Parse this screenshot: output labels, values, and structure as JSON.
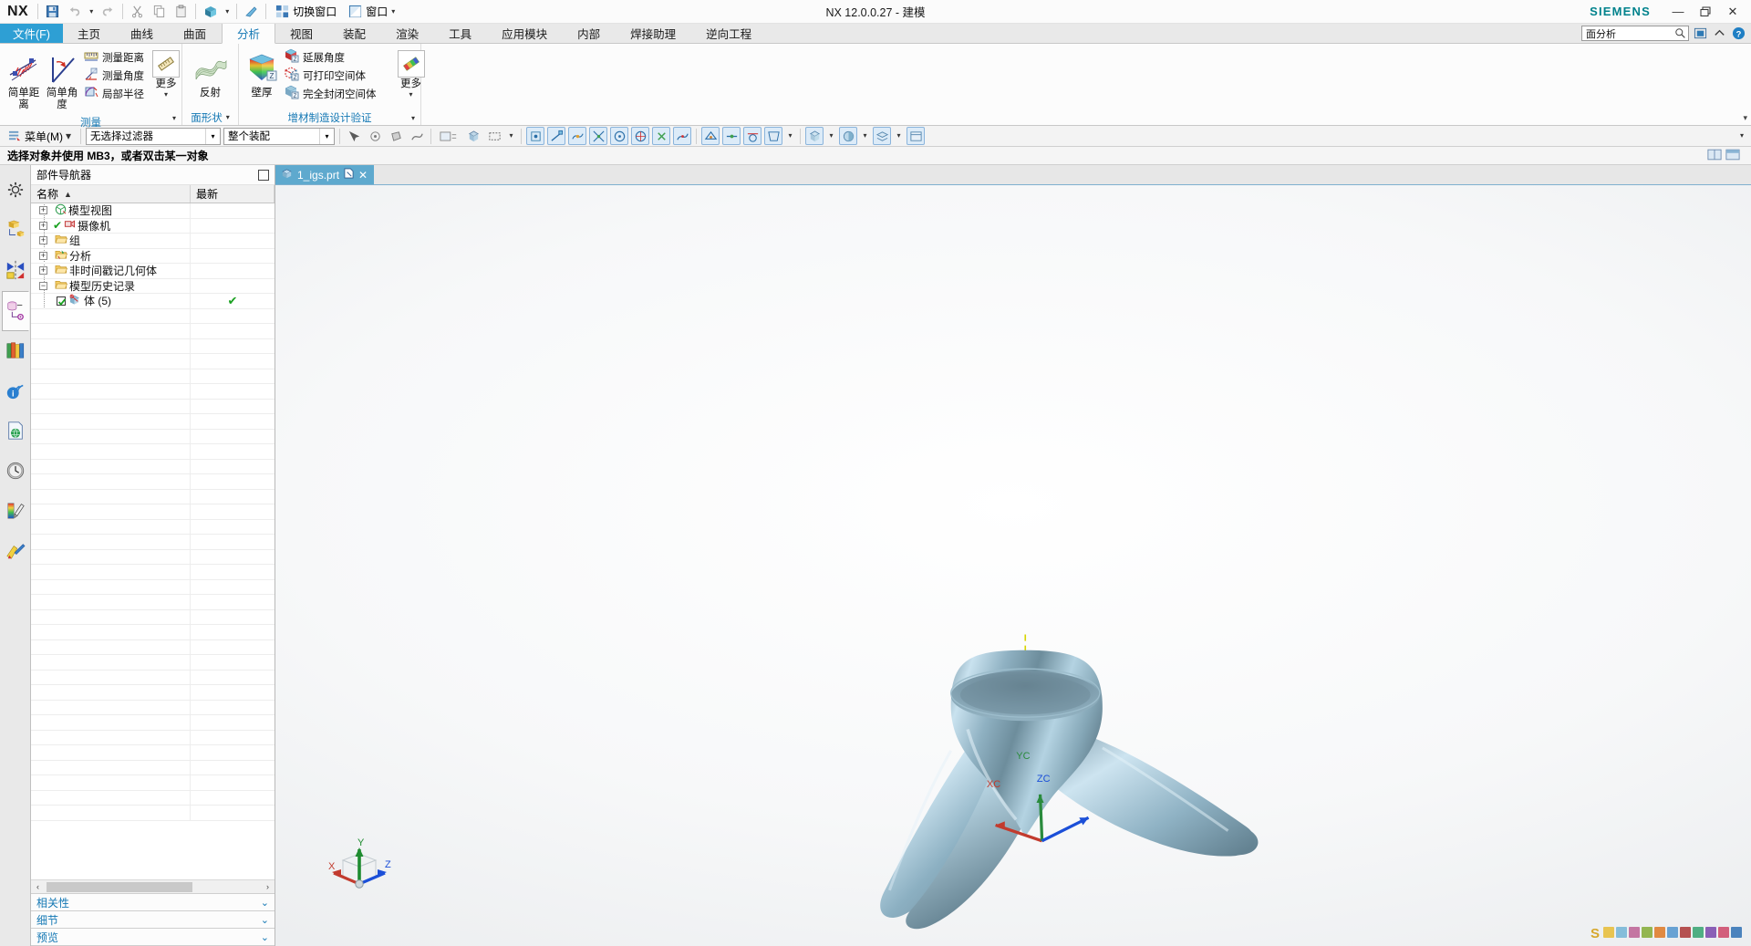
{
  "window": {
    "title": "NX 12.0.0.27 - 建模",
    "brand": "SIEMENS",
    "logo": "NX",
    "minimize": "—",
    "restore": "❐",
    "close": "✕"
  },
  "quick_access": {
    "buttons": [
      {
        "name": "save",
        "icon": "save-icon"
      },
      {
        "name": "undo",
        "icon": "undo-icon"
      },
      {
        "name": "undo-dropdown",
        "icon": "chevron-down-icon"
      },
      {
        "name": "redo",
        "icon": "redo-icon"
      },
      {
        "name": "cut",
        "icon": "scissors-icon"
      },
      {
        "name": "copy",
        "icon": "copy-icon"
      },
      {
        "name": "paste",
        "icon": "clipboard-icon"
      },
      {
        "name": "display-mode",
        "icon": "cube-icon"
      },
      {
        "name": "display-mode-dropdown",
        "icon": "chevron-down-icon"
      },
      {
        "name": "undo-brush",
        "icon": "brush-icon"
      }
    ],
    "switch_window_label": "切换窗口",
    "window_label": "窗口",
    "window_caret": "▾"
  },
  "ribbon_tabs": {
    "file": "文件(F)",
    "items": [
      "主页",
      "曲线",
      "曲面",
      "分析",
      "视图",
      "装配",
      "渲染",
      "工具",
      "应用模块",
      "内部",
      "焊接助理",
      "逆向工程"
    ],
    "active": "分析"
  },
  "search": {
    "value": "面分析",
    "icon": "magnifier-icon"
  },
  "header_icons": [
    {
      "name": "fullscreen-icon",
      "glyph": "▣"
    },
    {
      "name": "collapse-ribbon-icon",
      "glyph": "︿"
    },
    {
      "name": "help-icon",
      "glyph": "?"
    }
  ],
  "ribbon": {
    "groups": [
      {
        "name": "measure",
        "title": "测量",
        "title_caret": "▾",
        "large": [
          {
            "label": "简单距离",
            "icon": "simple-distance-icon"
          },
          {
            "label": "简单角度",
            "icon": "simple-angle-icon"
          }
        ],
        "small": [
          {
            "label": "测量距离",
            "icon": "measure-distance-icon"
          },
          {
            "label": "测量角度",
            "icon": "measure-angle-icon"
          },
          {
            "label": "局部半径",
            "icon": "local-radius-icon"
          }
        ],
        "more": {
          "label": "更多",
          "icon": "more-measure-icon",
          "caret": "▾"
        }
      },
      {
        "name": "face-shape",
        "title": "面形状",
        "title_caret": "▾",
        "large": [
          {
            "label": "反射",
            "icon": "reflection-icon"
          }
        ],
        "small": [],
        "more": null
      },
      {
        "name": "additive-manufacturing-validation",
        "title": "增材制造设计验证",
        "title_caret": "",
        "large": [
          {
            "label": "壁厚",
            "icon": "wall-thickness-icon"
          }
        ],
        "small": [
          {
            "label": "延展角度",
            "icon": "draft-angle-icon"
          },
          {
            "label": "可打印空间体",
            "icon": "printable-volume-icon"
          },
          {
            "label": "完全封闭空间体",
            "icon": "enclosed-volume-icon"
          }
        ],
        "more": {
          "label": "更多",
          "icon": "more-additive-icon",
          "caret": "▾"
        }
      }
    ],
    "collapse_caret": "▾"
  },
  "selection_bar": {
    "menu_label": "菜单(M)",
    "menu_caret": "▾",
    "filter": {
      "value": "无选择过滤器",
      "caret": "▾"
    },
    "scope": {
      "value": "整个装配",
      "caret": "▾"
    },
    "tools": [
      {
        "name": "select-object-icon",
        "active": false
      },
      {
        "name": "select-general-icon",
        "active": false
      },
      {
        "name": "select-face-icon",
        "active": false
      },
      {
        "name": "select-edge-icon",
        "active": false
      },
      {
        "name": "select-feature-icon",
        "active": false
      },
      {
        "name": "select-body-icon",
        "active": false
      },
      {
        "name": "rectangle-select-icon",
        "active": false
      },
      {
        "name": "snap-point-icon",
        "active": true
      },
      {
        "name": "snap-end-point-icon",
        "active": true
      },
      {
        "name": "snap-control-point-icon",
        "active": true
      },
      {
        "name": "snap-intersection-icon",
        "active": true
      },
      {
        "name": "snap-arc-center-icon",
        "active": true
      },
      {
        "name": "snap-quadrant-icon",
        "active": true
      },
      {
        "name": "snap-existing-point-icon",
        "active": true
      },
      {
        "name": "snap-curve-point-icon",
        "active": true
      },
      {
        "name": "snap-face-point-icon",
        "active": true
      },
      {
        "name": "snap-midpoint-icon",
        "active": true
      },
      {
        "name": "snap-tangent-icon",
        "active": true
      },
      {
        "name": "snap-bounded-grid-icon",
        "active": true
      },
      {
        "name": "snap-point-on-surface-icon",
        "active": true
      },
      {
        "name": "view-style-icon",
        "active": true
      },
      {
        "name": "render-style-icon",
        "active": true
      },
      {
        "name": "layer-visibility-icon",
        "active": true
      },
      {
        "name": "work-layer-icon",
        "active": true
      }
    ]
  },
  "cue": {
    "text": "选择对象并使用 MB3，或者双击某一对象"
  },
  "resource_bar": {
    "items": [
      {
        "name": "assembly-navigator",
        "icon": "gear-icon"
      },
      {
        "name": "part-navigator",
        "icon": "assembly-tree-icon"
      },
      {
        "name": "constraint-navigator",
        "icon": "mirror-icon"
      },
      {
        "name": "part-navigator-active",
        "icon": "part-tree-icon",
        "selected": true
      },
      {
        "name": "reuse-library",
        "icon": "books-icon"
      },
      {
        "name": "hd3d-tools",
        "icon": "info-wifi-icon"
      },
      {
        "name": "web-browser",
        "icon": "globe-page-icon"
      },
      {
        "name": "history",
        "icon": "clock-icon"
      },
      {
        "name": "process-studio",
        "icon": "gradient-pen-icon"
      },
      {
        "name": "role-manager",
        "icon": "role-icon"
      }
    ]
  },
  "navigator": {
    "title": "部件导航器",
    "pin_icon": "pin-icon",
    "columns": [
      {
        "label": "名称",
        "sort": "▲"
      },
      {
        "label": "最新"
      }
    ],
    "rows": [
      {
        "label": "模型视图",
        "expander": "+",
        "icon": "model-view-icon",
        "indent": 0,
        "check": false,
        "status": ""
      },
      {
        "label": "摄像机",
        "expander": "+",
        "icon": "camera-icon",
        "indent": 0,
        "check": false,
        "status": "",
        "leadcheck": "✔"
      },
      {
        "label": "组",
        "expander": "+",
        "icon": "folder-icon",
        "indent": 0,
        "check": false,
        "status": ""
      },
      {
        "label": "分析",
        "expander": "+",
        "icon": "analysis-folder-icon",
        "indent": 0,
        "check": false,
        "status": ""
      },
      {
        "label": "非时间戳记几何体",
        "expander": "+",
        "icon": "folder-icon",
        "indent": 0,
        "check": false,
        "status": ""
      },
      {
        "label": "模型历史记录",
        "expander": "−",
        "icon": "folder-icon",
        "indent": 0,
        "check": false,
        "status": ""
      },
      {
        "label": "体 (5)",
        "expander": "",
        "icon": "body-icon",
        "indent": 1,
        "check": true,
        "status": "✔"
      }
    ],
    "hscroll": {
      "left_arrow": "‹",
      "right_arrow": "›"
    },
    "accordion": [
      {
        "label": "相关性",
        "chevron": "⌄"
      },
      {
        "label": "细节",
        "chevron": "⌄"
      },
      {
        "label": "预览",
        "chevron": "⌄"
      }
    ]
  },
  "viewport": {
    "tab": {
      "label": "1_igs.prt",
      "modified_icon": "modified-icon",
      "close": "✕",
      "icon": "part-icon"
    },
    "tab_right_icons": [
      {
        "name": "viewport-split-icon"
      },
      {
        "name": "viewport-dock-icon"
      }
    ],
    "wcs": {
      "x": "XC",
      "y": "YC",
      "z": "ZC"
    },
    "triad": {
      "x": "X",
      "y": "Y",
      "z": "Z"
    },
    "colors": {
      "x_axis": "#c23b2e",
      "y_axis": "#2a8b3d",
      "z_axis": "#1b4fd8",
      "model_light": "#cfe3ec",
      "model_mid": "#8fb3c4",
      "model_dark": "#63808f",
      "dashed_axis": "#d8d400"
    }
  },
  "theme": {
    "accent": "#2e9fd4",
    "link": "#1478b4",
    "siemens": "#00828c",
    "tab_active_bg": "#fcfcfc"
  }
}
